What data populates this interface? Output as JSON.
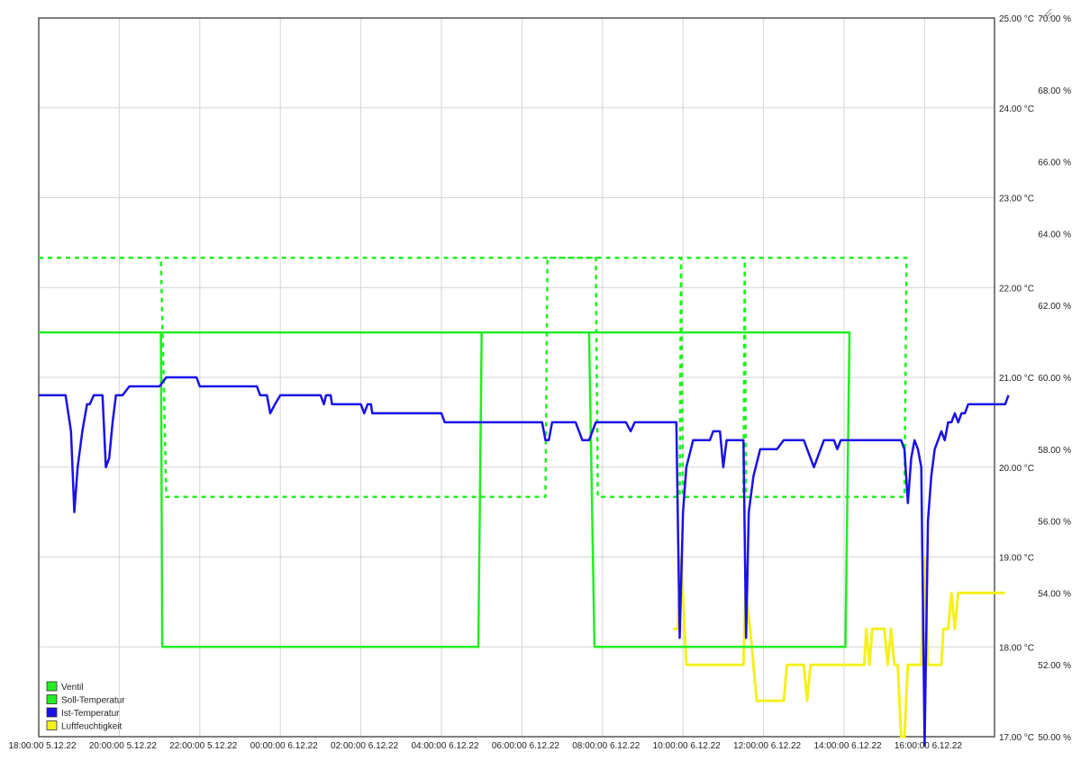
{
  "chart_data": {
    "type": "line",
    "x_start": "18:00:00 5.12.22",
    "x_ticks": [
      "18:00:00 5.12.22",
      "20:00:00 5.12.22",
      "22:00:00 5.12.22",
      "00:00:00 6.12.22",
      "02:00:00 6.12.22",
      "04:00:00 6.12.22",
      "06:00:00 6.12.22",
      "08:00:00 6.12.22",
      "10:00:00 6.12.22",
      "12:00:00 6.12.22",
      "14:00:00 6.12.22",
      "16:00:00 6.12.22"
    ],
    "y_left_ticks": [
      "17.00 °C",
      "18.00 °C",
      "19.00 °C",
      "20.00 °C",
      "21.00 °C",
      "22.00 °C",
      "23.00 °C",
      "24.00 °C",
      "25.00 °C"
    ],
    "y_right_ticks": [
      "50.00 %",
      "52.00 %",
      "54.00 %",
      "56.00 %",
      "58.00 %",
      "60.00 %",
      "62.00 %",
      "64.00 %",
      "66.00 %",
      "68.00 %",
      "70.00 %"
    ],
    "y_left_range": [
      17,
      25
    ],
    "y_right_range": [
      50,
      70
    ],
    "grid": true,
    "legend_position": "bottom-left",
    "series": [
      {
        "name": "Ventil",
        "color": "#22ee22",
        "axis": "left",
        "style": "solid",
        "points": [
          [
            "18:00",
            21.5
          ],
          [
            "21:02",
            21.5
          ],
          [
            "21:04",
            18.0
          ],
          [
            "04:55",
            18.0
          ],
          [
            "05:00",
            21.5
          ],
          [
            "07:40",
            21.5
          ],
          [
            "07:48",
            18.0
          ],
          [
            "14:02",
            18.0
          ],
          [
            "14:08",
            21.5
          ],
          [
            "18:58",
            21.5
          ]
        ]
      },
      {
        "name": "Soll-Temperatur",
        "color": "#22ee22",
        "axis": "left",
        "style": "dashed",
        "points": [
          [
            "18:00",
            22.33
          ],
          [
            "21:02",
            22.33
          ],
          [
            "21:10",
            19.67
          ],
          [
            "06:35",
            19.67
          ],
          [
            "06:38",
            22.33
          ],
          [
            "07:50",
            22.33
          ],
          [
            "07:53",
            19.67
          ],
          [
            "09:55",
            19.67
          ],
          [
            "09:57",
            22.33
          ],
          [
            "10:00",
            19.67
          ],
          [
            "11:30",
            19.67
          ],
          [
            "11:32",
            22.3
          ],
          [
            "11:34",
            19.67
          ],
          [
            "15:30",
            19.67
          ],
          [
            "15:33",
            22.33
          ],
          [
            "18:58",
            22.33
          ]
        ]
      },
      {
        "name": "Ist-Temperatur",
        "color": "#1a10e8",
        "axis": "left",
        "style": "solid",
        "points": [
          [
            "18:00",
            20.8
          ],
          [
            "18:40",
            20.8
          ],
          [
            "18:48",
            20.4
          ],
          [
            "18:53",
            19.5
          ],
          [
            "18:58",
            20.0
          ],
          [
            "19:05",
            20.4
          ],
          [
            "19:12",
            20.7
          ],
          [
            "19:16",
            20.7
          ],
          [
            "19:22",
            20.8
          ],
          [
            "19:35",
            20.8
          ],
          [
            "19:40",
            20.0
          ],
          [
            "19:45",
            20.1
          ],
          [
            "19:50",
            20.5
          ],
          [
            "19:55",
            20.8
          ],
          [
            "20:05",
            20.8
          ],
          [
            "20:15",
            20.9
          ],
          [
            "21:00",
            20.9
          ],
          [
            "21:10",
            21.0
          ],
          [
            "21:55",
            21.0
          ],
          [
            "22:00",
            20.9
          ],
          [
            "23:25",
            20.9
          ],
          [
            "23:30",
            20.8
          ],
          [
            "23:40",
            20.8
          ],
          [
            "23:45",
            20.6
          ],
          [
            "23:52",
            20.7
          ],
          [
            "24:00",
            20.8
          ],
          [
            "25:00",
            20.8
          ],
          [
            "25:05",
            20.7
          ],
          [
            "25:08",
            20.8
          ],
          [
            "25:15",
            20.8
          ],
          [
            "25:17",
            20.7
          ],
          [
            "26:00",
            20.7
          ],
          [
            "26:05",
            20.6
          ],
          [
            "26:10",
            20.7
          ],
          [
            "26:15",
            20.7
          ],
          [
            "26:17",
            20.6
          ],
          [
            "28:00",
            20.6
          ],
          [
            "28:05",
            20.5
          ],
          [
            "30:30",
            20.5
          ],
          [
            "30:35",
            20.3
          ],
          [
            "30:40",
            20.3
          ],
          [
            "30:45",
            20.5
          ],
          [
            "31:00",
            20.5
          ],
          [
            "31:20",
            20.5
          ],
          [
            "31:30",
            20.3
          ],
          [
            "31:40",
            20.3
          ],
          [
            "31:50",
            20.5
          ],
          [
            "32:35",
            20.5
          ],
          [
            "32:42",
            20.4
          ],
          [
            "32:48",
            20.5
          ],
          [
            "33:30",
            20.5
          ],
          [
            "33:50",
            20.5
          ],
          [
            "33:55",
            18.1
          ],
          [
            "34:00",
            19.5
          ],
          [
            "34:05",
            20.0
          ],
          [
            "34:15",
            20.3
          ],
          [
            "34:40",
            20.3
          ],
          [
            "34:45",
            20.4
          ],
          [
            "34:55",
            20.4
          ],
          [
            "35:00",
            20.0
          ],
          [
            "35:05",
            20.3
          ],
          [
            "35:30",
            20.3
          ],
          [
            "35:34",
            18.1
          ],
          [
            "35:38",
            19.5
          ],
          [
            "35:45",
            19.9
          ],
          [
            "35:55",
            20.2
          ],
          [
            "36:20",
            20.2
          ],
          [
            "36:30",
            20.3
          ],
          [
            "37:00",
            20.3
          ],
          [
            "37:10",
            20.1
          ],
          [
            "37:15",
            20.0
          ],
          [
            "37:25",
            20.2
          ],
          [
            "37:30",
            20.3
          ],
          [
            "37:45",
            20.3
          ],
          [
            "37:50",
            20.2
          ],
          [
            "37:55",
            20.3
          ],
          [
            "39:25",
            20.3
          ],
          [
            "39:30",
            20.2
          ],
          [
            "39:35",
            19.6
          ],
          [
            "39:40",
            20.1
          ],
          [
            "39:45",
            20.3
          ],
          [
            "39:50",
            20.2
          ],
          [
            "39:55",
            20.0
          ],
          [
            "40:00",
            16.9
          ],
          [
            "40:05",
            19.4
          ],
          [
            "40:10",
            19.9
          ],
          [
            "40:15",
            20.2
          ],
          [
            "40:20",
            20.3
          ],
          [
            "40:25",
            20.4
          ],
          [
            "40:30",
            20.3
          ],
          [
            "40:35",
            20.5
          ],
          [
            "40:40",
            20.5
          ],
          [
            "40:45",
            20.6
          ],
          [
            "40:50",
            20.5
          ],
          [
            "40:55",
            20.6
          ],
          [
            "41:00",
            20.6
          ],
          [
            "41:05",
            20.7
          ],
          [
            "42:00",
            20.7
          ],
          [
            "42:05",
            20.8
          ]
        ]
      },
      {
        "name": "Luftfeuchtigkeit",
        "color": "#f4f11e",
        "axis": "right",
        "style": "solid",
        "points": [
          [
            "33:45",
            53.0
          ],
          [
            "33:52",
            53.0
          ],
          [
            "33:57",
            55.0
          ],
          [
            "34:05",
            52.0
          ],
          [
            "35:30",
            52.0
          ],
          [
            "35:33",
            54.0
          ],
          [
            "35:40",
            53.0
          ],
          [
            "35:50",
            51.0
          ],
          [
            "36:30",
            51.0
          ],
          [
            "36:35",
            52.0
          ],
          [
            "37:00",
            52.0
          ],
          [
            "37:05",
            51.0
          ],
          [
            "37:10",
            52.0
          ],
          [
            "38:30",
            52.0
          ],
          [
            "38:33",
            53.0
          ],
          [
            "38:38",
            52.0
          ],
          [
            "38:42",
            53.0
          ],
          [
            "39:00",
            53.0
          ],
          [
            "39:05",
            52.0
          ],
          [
            "39:10",
            53.0
          ],
          [
            "39:15",
            52.0
          ],
          [
            "39:20",
            52.0
          ],
          [
            "39:25",
            50.0
          ],
          [
            "39:30",
            50.0
          ],
          [
            "39:35",
            52.0
          ],
          [
            "39:55",
            52.0
          ],
          [
            "40:00",
            55.0
          ],
          [
            "40:05",
            52.0
          ],
          [
            "40:25",
            52.0
          ],
          [
            "40:28",
            53.0
          ],
          [
            "40:35",
            53.0
          ],
          [
            "40:40",
            54.0
          ],
          [
            "40:45",
            53.0
          ],
          [
            "40:50",
            54.0
          ],
          [
            "42:00",
            54.0
          ]
        ]
      }
    ]
  }
}
